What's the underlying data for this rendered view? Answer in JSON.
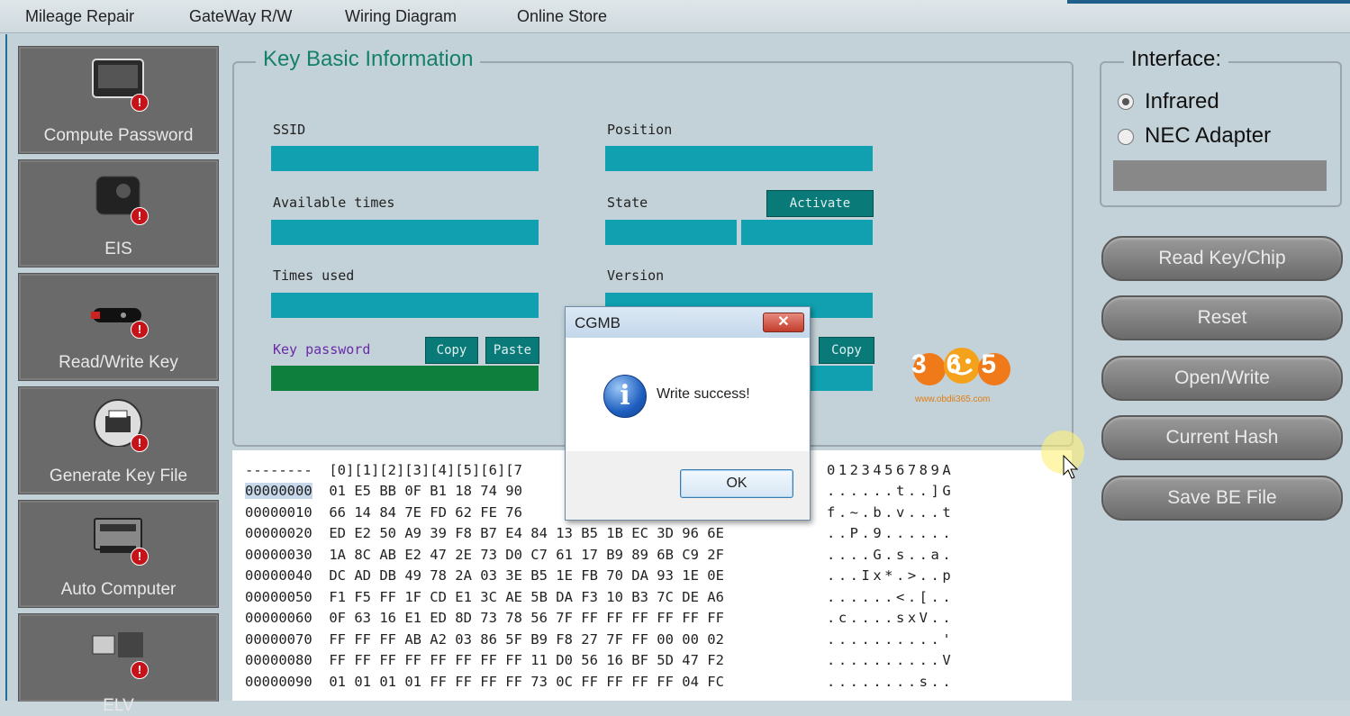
{
  "menu": {
    "items": [
      "Mileage Repair",
      "GateWay R/W",
      "Wiring Diagram",
      "Online Store"
    ]
  },
  "sidebar": {
    "items": [
      {
        "label": "Compute Password",
        "badge": "!"
      },
      {
        "label": "EIS",
        "badge": "!"
      },
      {
        "label": "Read/Write Key",
        "badge": "!"
      },
      {
        "label": "Generate Key File",
        "badge": "!"
      },
      {
        "label": "Auto Computer",
        "badge": "!"
      },
      {
        "label": "ELV",
        "badge": "!"
      }
    ]
  },
  "key_info": {
    "title": "Key Basic Information",
    "ssid_label": "SSID",
    "available_label": "Available times",
    "used_label": "Times used",
    "password_label": "Key password",
    "position_label": "Position",
    "state_label": "State",
    "version_label": "Version",
    "activate_label": "Activate",
    "copy_label": "Copy",
    "paste_label": "Paste",
    "copy2_label": "Copy"
  },
  "interface": {
    "title": "Interface:",
    "options": [
      "Infrared",
      "NEC Adapter"
    ],
    "selected": "Infrared"
  },
  "actions": [
    "Read Key/Chip",
    "Reset",
    "Open/Write",
    "Current Hash",
    "Save BE File"
  ],
  "hex": {
    "header": "--------  [0][1][2][3][4][5][6][7",
    "ascii_header": "0123456789A",
    "rows": [
      {
        "addr": "00000000",
        "bytes": "01 E5 BB 0F B1 18 74 90",
        "ascii": "......t..]G"
      },
      {
        "addr": "00000010",
        "bytes": "66 14 84 7E FD 62 FE 76",
        "ascii": "f.~.b.v...t"
      },
      {
        "addr": "00000020",
        "bytes": "ED E2 50 A9 39 F8 B7 E4 84 13 B5 1B EC 3D 96 6E",
        "ascii": "..P.9......"
      },
      {
        "addr": "00000030",
        "bytes": "1A 8C AB E2 47 2E 73 D0 C7 61 17 B9 89 6B C9 2F",
        "ascii": "....G.s..a."
      },
      {
        "addr": "00000040",
        "bytes": "DC AD DB 49 78 2A 03 3E B5 1E FB 70 DA 93 1E 0E",
        "ascii": "...Ix*.>..p"
      },
      {
        "addr": "00000050",
        "bytes": "F1 F5 FF 1F CD E1 3C AE 5B DA F3 10 B3 7C DE A6",
        "ascii": "......<.[.."
      },
      {
        "addr": "00000060",
        "bytes": "0F 63 16 E1 ED 8D 73 78 56 7F FF FF FF FF FF FF",
        "ascii": ".c....sxV.."
      },
      {
        "addr": "00000070",
        "bytes": "FF FF FF AB A2 03 86 5F B9 F8 27 7F FF 00 00 02",
        "ascii": "..........'"
      },
      {
        "addr": "00000080",
        "bytes": "FF FF FF FF FF FF FF FF 11 D0 56 16 BF 5D 47 F2",
        "ascii": "..........V"
      },
      {
        "addr": "00000090",
        "bytes": "01 01 01 01 FF FF FF FF 73 0C FF FF FF FF 04 FC",
        "ascii": "........s.."
      }
    ]
  },
  "dialog": {
    "title": "CGMB",
    "close": "✕",
    "message": "Write success!",
    "ok_label": "OK",
    "info_glyph": "i"
  },
  "watermark": {
    "logo_text": "365",
    "url": "www.obdii365.com"
  }
}
